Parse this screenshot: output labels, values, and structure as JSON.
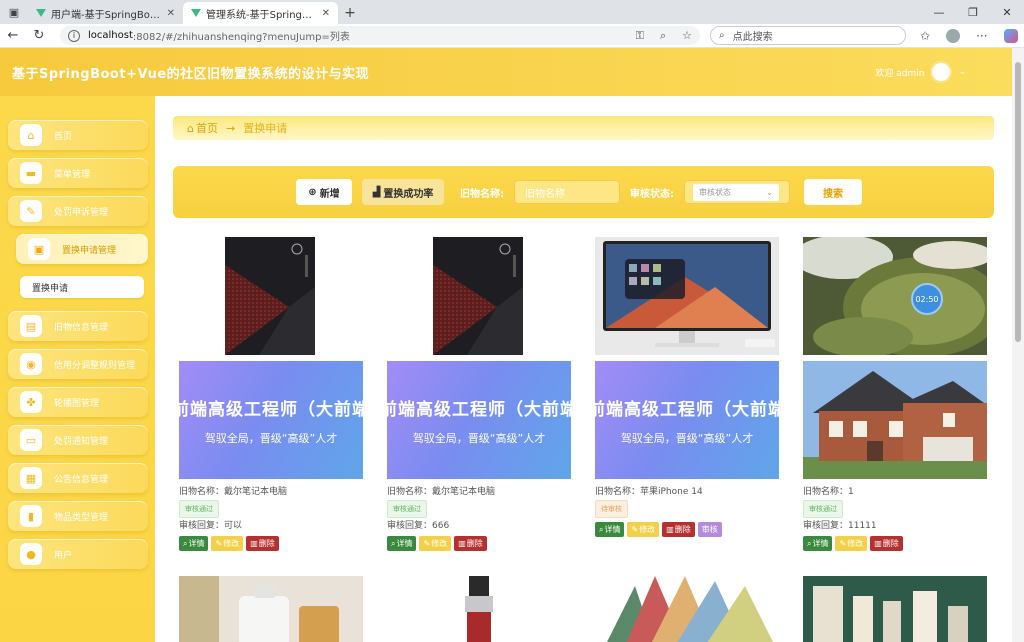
{
  "browser": {
    "tabs": [
      {
        "title": "用户端-基于SpringBoot+Vue的社"
      },
      {
        "title": "管理系统-基于SpringBoot+Vue的"
      }
    ],
    "url_host": "localhost",
    "url_path": ":8082/#/zhihuanshenqing?menuJump=列表",
    "search_placeholder": "点此搜索"
  },
  "header": {
    "title": "基于SpringBoot+Vue的社区旧物置换系统的设计与实现",
    "welcome": "欢迎 admin"
  },
  "sidebar": {
    "items": [
      {
        "label": "首页",
        "icon": "home-icon"
      },
      {
        "label": "菜单管理",
        "icon": "menu-icon"
      },
      {
        "label": "处罚申诉管理",
        "icon": "appeal-icon"
      },
      {
        "label": "置换申请管理",
        "icon": "briefcase-icon"
      },
      {
        "label": "旧物信息管理",
        "icon": "box-icon"
      },
      {
        "label": "信用分调整规则管理",
        "icon": "rule-icon"
      },
      {
        "label": "轮播图管理",
        "icon": "grid-icon"
      },
      {
        "label": "处罚通知管理",
        "icon": "notice-icon"
      },
      {
        "label": "公告信息管理",
        "icon": "announce-icon"
      },
      {
        "label": "物品类型管理",
        "icon": "category-icon"
      },
      {
        "label": "用户",
        "icon": "user-icon"
      }
    ],
    "sub_item": "置换申请"
  },
  "breadcrumb": {
    "home": "首页",
    "current": "置换申请"
  },
  "filter": {
    "add_label": "新增",
    "rate_label": "置换成功率",
    "name_label": "旧物名称:",
    "name_placeholder": "旧物名称",
    "status_label": "审核状态:",
    "status_placeholder": "审核状态",
    "search_label": "搜索"
  },
  "cards": [
    {
      "image": "desktop-tower",
      "banner_line1": "前端高级工程师（大前端",
      "banner_line2": "驾驭全局，晋级“高级”人才",
      "name_line": "旧物名称：戴尔笔记本电脑",
      "status": "审核通过",
      "reply_line": "审核回复：可以",
      "actions": [
        "详情",
        "修改",
        "删除"
      ]
    },
    {
      "image": "desktop-tower",
      "banner_line1": "前端高级工程师（大前端",
      "banner_line2": "驾驭全局，晋级“高级”人才",
      "name_line": "旧物名称：戴尔笔记本电脑",
      "status": "审核通过",
      "reply_line": "审核回复：666",
      "actions": [
        "详情",
        "修改",
        "删除"
      ]
    },
    {
      "image": "monitor",
      "banner_line1": "前端高级工程师（大前端",
      "banner_line2": "驾驭全局，晋级“高级”人才",
      "name_line": "旧物名称：苹果iPhone 14",
      "status": "待审核",
      "reply_line": "",
      "actions": [
        "详情",
        "修改",
        "删除",
        "审核"
      ]
    },
    {
      "image": "tea",
      "banner_line1": "",
      "banner_line2": "",
      "name_line": "旧物名称：1",
      "status": "审核通过",
      "reply_line": "审核回复：11111",
      "actions": [
        "详情",
        "修改",
        "删除"
      ]
    }
  ],
  "timer_badge": "02:50",
  "colors": {
    "theme_yellow": "#fbd94b",
    "detail_green": "#3a8a3e",
    "edit_yellow": "#f2d049",
    "delete_red": "#b53030",
    "review_purple": "#b58ad8"
  }
}
